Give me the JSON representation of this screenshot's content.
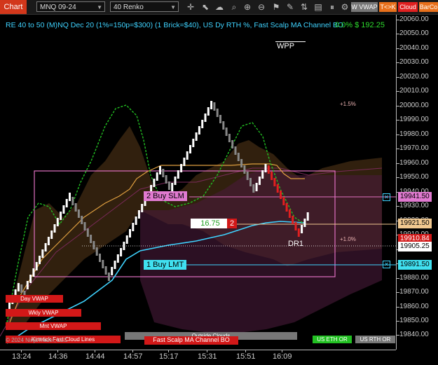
{
  "toolbar": {
    "chart_label": "Chart",
    "instrument": "MNQ 09-24",
    "interval": "40 Renko",
    "buttons": {
      "vwap": "W VWAP",
      "tk": "T<>K",
      "cloud": "Cloud",
      "barco": "BarCo"
    },
    "icons": [
      "crosshair-icon",
      "cursor-icon",
      "cloud-up-icon",
      "magnify-icon",
      "zoom-in-icon",
      "zoom-out-icon",
      "strategy-icon",
      "drawing-tools-icon",
      "indicators-icon",
      "data-box-icon",
      "pause-icon",
      "settings-icon",
      "properties-icon",
      "link-icon"
    ]
  },
  "header": {
    "title": "RE 40 to 50 (M)NQ Dec 20 (1%=150p=$300) (1 Brick=$40), US Dy RTH %, Fast Scalp MA Channel BO",
    "pnl": "0.0% $ 192.25"
  },
  "annotations": {
    "wpp": "WPP",
    "pct_upper": "+1.5%",
    "pct_lower": "+1.0%",
    "dr1": "DR1",
    "buy_slm": "2 Buy SLM",
    "buy_lmt": "1 Buy LMT",
    "order_price": "16.75",
    "order_qty": "2"
  },
  "legend_bars": {
    "day_vwap": "Day VWAP",
    "wkly_vwap": "Wkly VWAP",
    "mnt_vwap": "Mnt VWAP",
    "ribbon_text": "Kinetick Fast Cloud Lines",
    "copyright": "© 2024 NinjaTrader, LLC",
    "fast_scalp": "Fast Scalp MA Channel BO",
    "outside_clouds": "Outside Clouds",
    "us_eth_or": "US ETH OR",
    "us_rth_or": "US RTH OR"
  },
  "price_axis": {
    "ticks": [
      "20060.00",
      "20050.00",
      "20040.00",
      "20030.00",
      "20020.00",
      "20010.00",
      "20000.00",
      "19990.00",
      "19980.00",
      "19970.00",
      "19960.00",
      "19950.00",
      "19940.00",
      "19930.00",
      "19920.00",
      "19910.00",
      "19900.00",
      "19890.00",
      "19880.00",
      "19870.00",
      "19860.00",
      "19850.00",
      "19840.00"
    ],
    "labels": [
      {
        "text": "19941.50",
        "bg": "#e07ad0",
        "color": "#000"
      },
      {
        "text": "19921.50",
        "bg": "#f0c890",
        "color": "#000"
      },
      {
        "text": "19910.84",
        "bg": "#d21818",
        "color": "#fff"
      },
      {
        "text": "19905.25",
        "bg": "#ffffff",
        "color": "#000"
      },
      {
        "text": "19891.50",
        "bg": "#40e0f0",
        "color": "#000"
      }
    ]
  },
  "time_axis": [
    "13:24",
    "14:36",
    "14:44",
    "14:57",
    "15:17",
    "15:31",
    "15:51",
    "16:09"
  ],
  "colors": {
    "up": "#ffffff",
    "down": "#e02020",
    "neutral": "#888888",
    "vwap": "#3fd3ff",
    "fast_ma": "#22c022",
    "channel": "#e0a040",
    "box": "#e070c0"
  }
}
